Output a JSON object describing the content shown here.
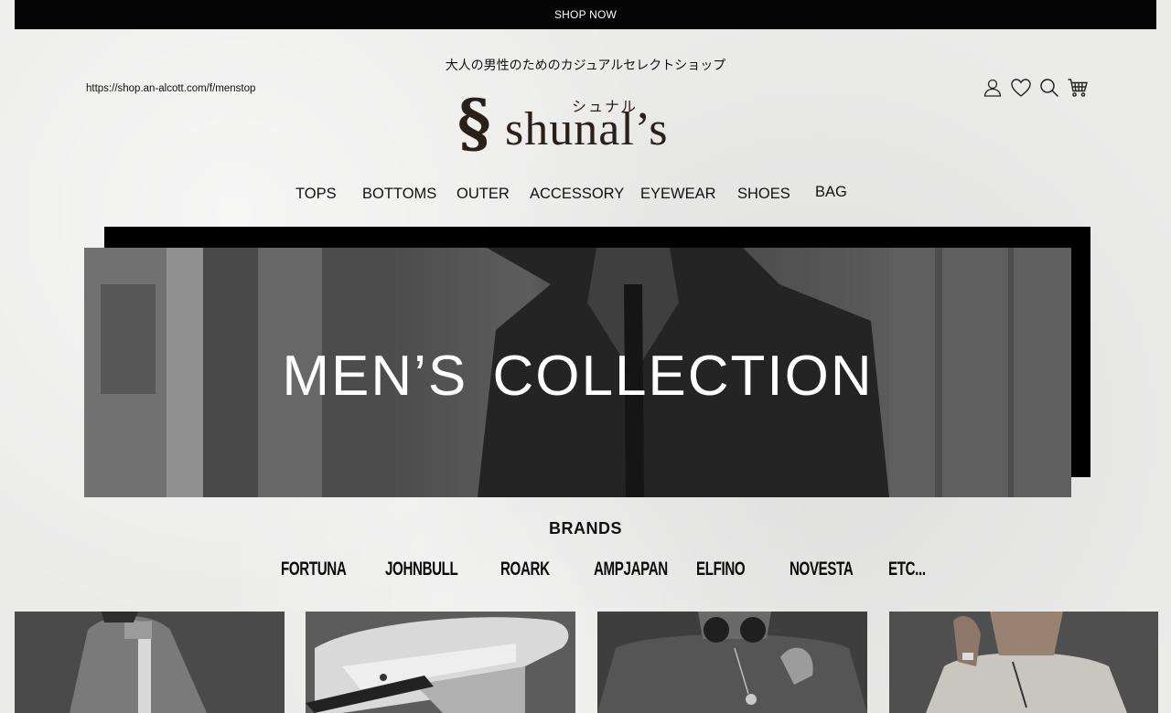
{
  "topbar": {
    "label": "SHOP NOW"
  },
  "header": {
    "tagline": "大人の男性のためのカジュアルセレクトショップ",
    "url": "https://shop.an-alcott.com/f/menstop",
    "logo": {
      "mark": "§",
      "word": "shunal’s",
      "kana": "シュナル"
    },
    "icons": [
      "user-icon",
      "heart-icon",
      "search-icon",
      "cart-icon"
    ]
  },
  "nav": [
    "TOPS",
    "BOTTOMS",
    "OUTER",
    "ACCESSORY",
    "EYEWEAR",
    "SHOES",
    "BAG"
  ],
  "hero": {
    "title": "MEN’S COLLECTION"
  },
  "brands": {
    "title": "BRANDS",
    "items": [
      "FORTUNA",
      "JOHNBULL",
      "ROARK",
      "AMPJAPAN",
      "ELFINO",
      "NOVESTA",
      "ETC..."
    ]
  },
  "colors": {
    "topbar": "#050505",
    "background": "#ebebea",
    "text": "#111111",
    "logo": "#2a2018"
  }
}
